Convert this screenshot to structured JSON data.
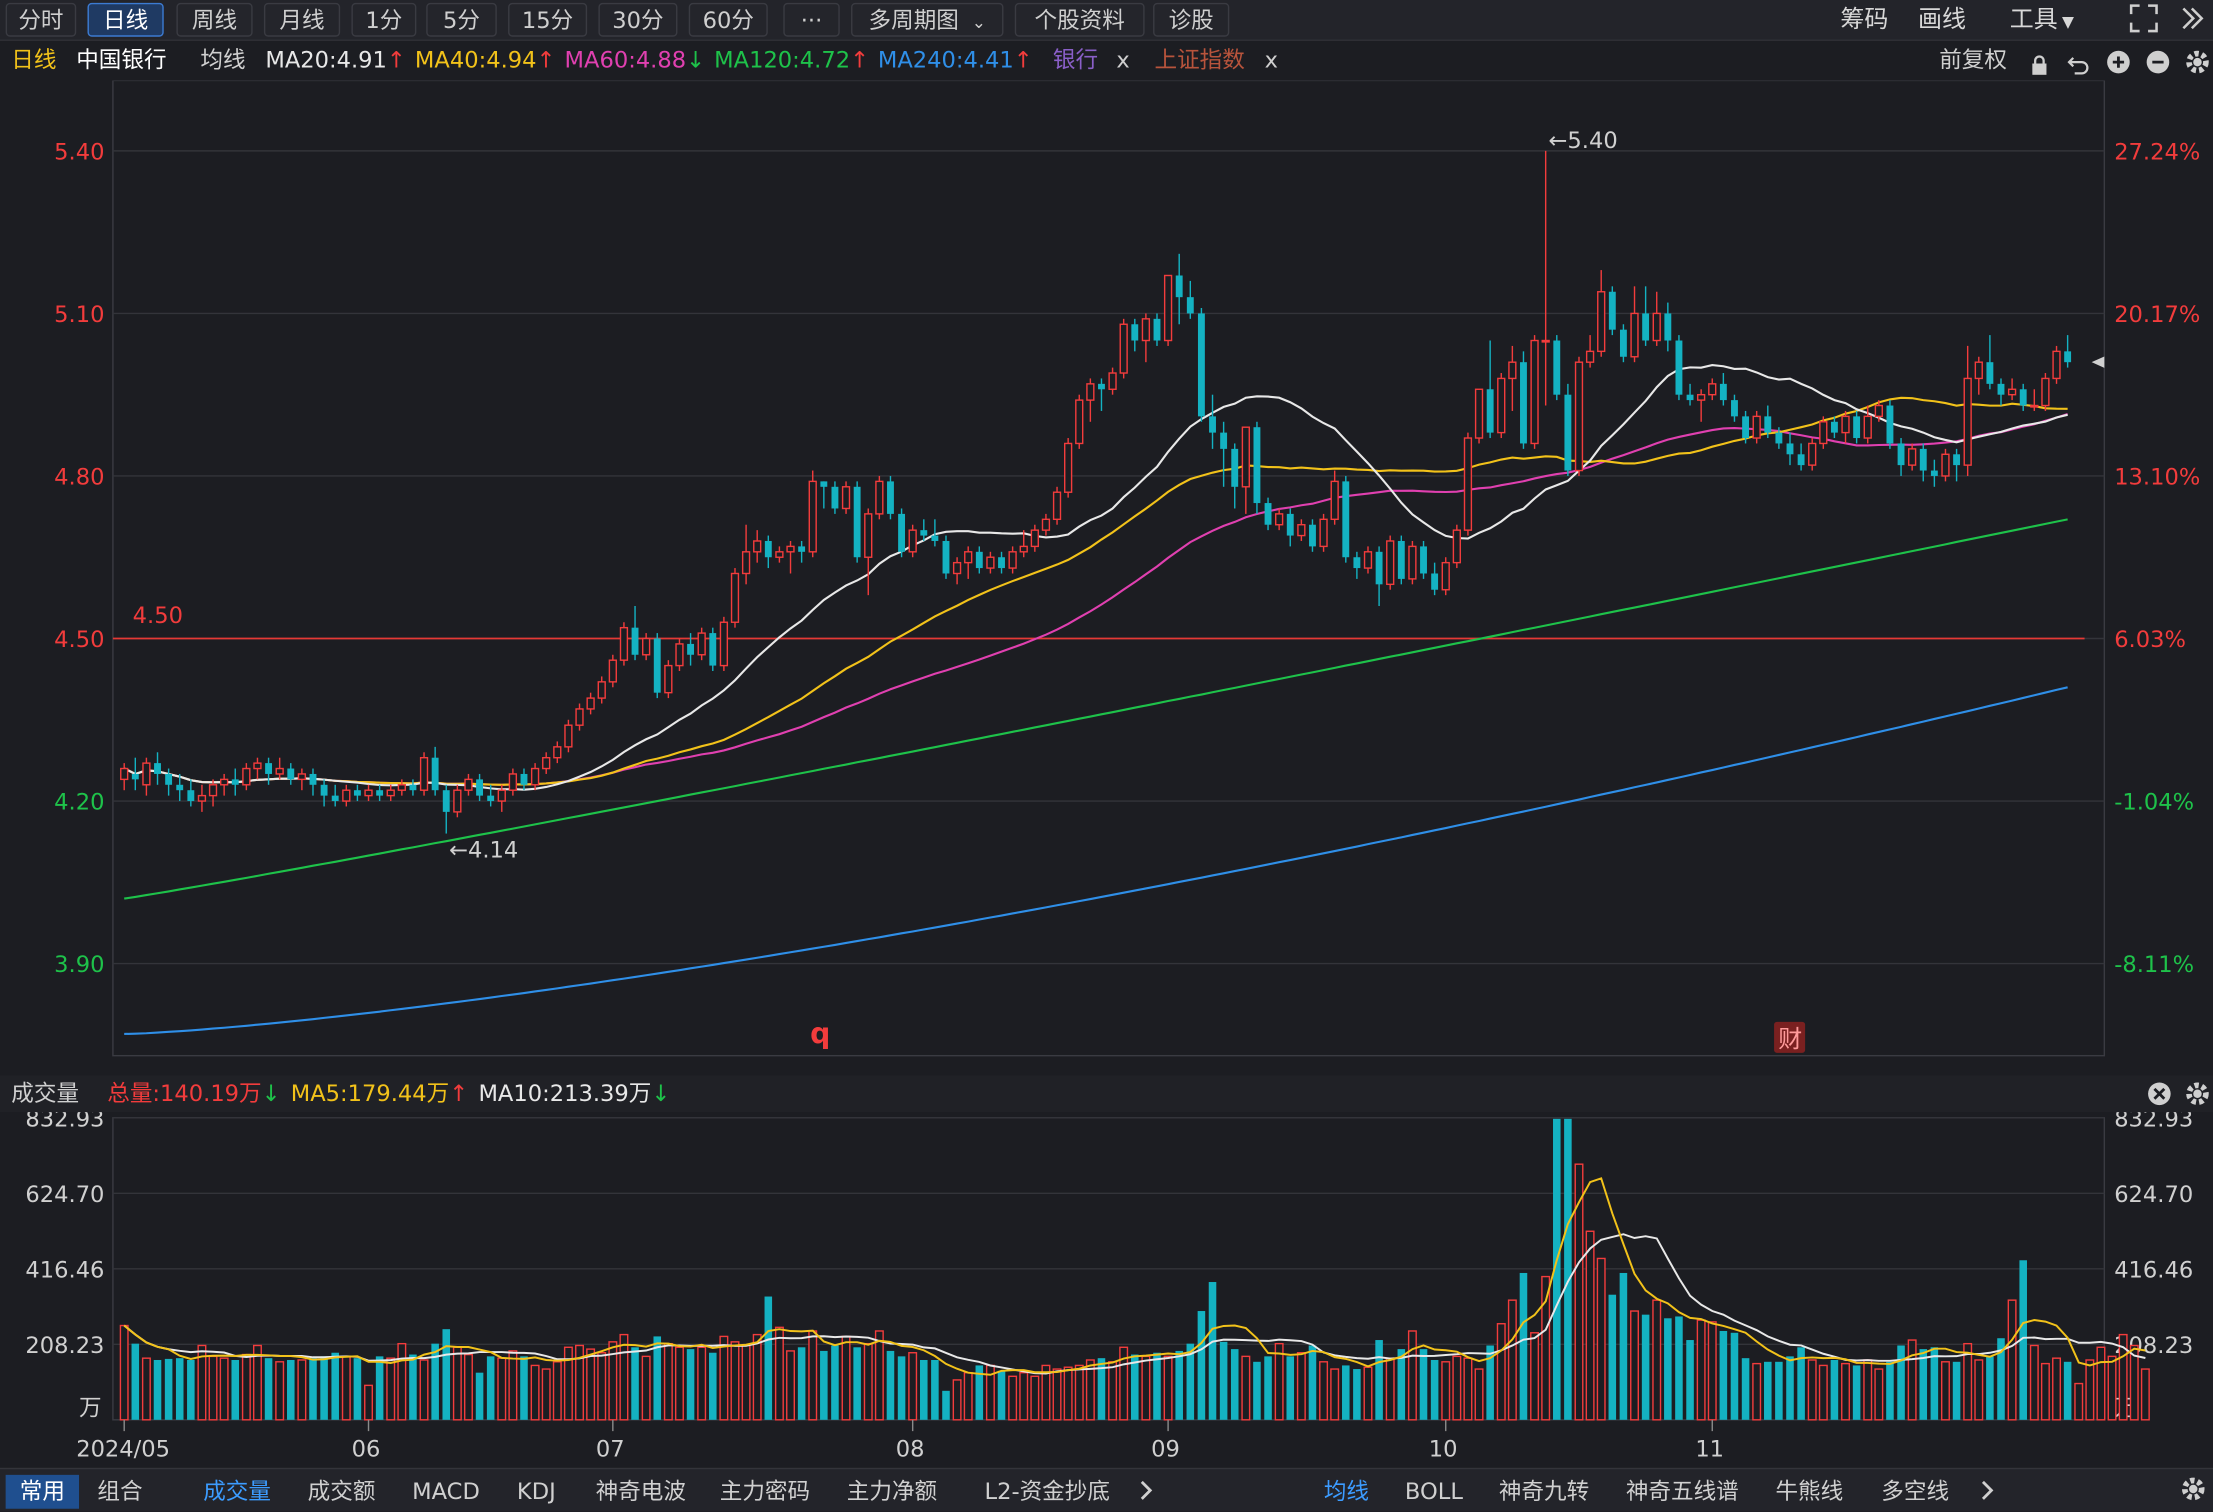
{
  "period_tabs": [
    {
      "label": "分时",
      "active": false
    },
    {
      "label": "日线",
      "active": true
    },
    {
      "label": "周线",
      "active": false
    },
    {
      "label": "月线",
      "active": false
    },
    {
      "label": "1分",
      "active": false
    },
    {
      "label": "5分",
      "active": false
    },
    {
      "label": "15分",
      "active": false
    },
    {
      "label": "30分",
      "active": false
    },
    {
      "label": "60分",
      "active": false
    }
  ],
  "toolbar": {
    "more_label": "···",
    "multi_period_label": "多周期图",
    "stock_info_label": "个股资料",
    "diagnose_label": "诊股",
    "chips_label": "筹码",
    "draw_label": "画线",
    "tools_label": "工具"
  },
  "info": {
    "period": "日线",
    "stock_name": "中国银行",
    "ma_type": "均线",
    "ma20": "MA20:4.91",
    "ma40": "MA40:4.94",
    "ma60": "MA60:4.88",
    "ma120": "MA120:4.72",
    "ma240": "MA240:4.41",
    "compare1": "银行",
    "compare2": "上证指数",
    "close_mark": "x",
    "adjust": "前复权"
  },
  "colors": {
    "up": "#f23c3c",
    "down": "#14b2c2",
    "ma20": "#e8e8e8",
    "ma40": "#f2c21a",
    "ma60": "#e040b0",
    "ma120": "#1ec24a",
    "ma240": "#2f8fe8",
    "grid": "#33343a"
  },
  "chart_data": [
    {
      "type": "candlestick",
      "title": "",
      "y_ticks_left": [
        "5.40",
        "5.10",
        "4.80",
        "4.50",
        "4.20",
        "3.90"
      ],
      "y_ticks_right": [
        "27.24%",
        "20.17%",
        "13.10%",
        "6.03%",
        "-1.04%",
        "-8.11%"
      ],
      "ylim": [
        3.73,
        5.53
      ],
      "x_labels": [
        "2024/05",
        "06",
        "07",
        "08",
        "09",
        "10",
        "11"
      ],
      "reference_line": {
        "value": 4.5,
        "label": "4.50"
      },
      "max_label": "←5.40",
      "min_label": "←4.14",
      "event_markers": [
        "q",
        "财"
      ],
      "candles": [
        [
          4.24,
          4.26,
          4.27,
          4.22
        ],
        [
          4.25,
          4.24,
          4.28,
          4.22
        ],
        [
          4.23,
          4.27,
          4.28,
          4.21
        ],
        [
          4.27,
          4.25,
          4.29,
          4.23
        ],
        [
          4.25,
          4.23,
          4.26,
          4.21
        ],
        [
          4.23,
          4.22,
          4.25,
          4.2
        ],
        [
          4.22,
          4.2,
          4.24,
          4.19
        ],
        [
          4.2,
          4.21,
          4.23,
          4.18
        ],
        [
          4.21,
          4.23,
          4.24,
          4.19
        ],
        [
          4.23,
          4.24,
          4.25,
          4.21
        ],
        [
          4.24,
          4.23,
          4.26,
          4.21
        ],
        [
          4.23,
          4.26,
          4.27,
          4.22
        ],
        [
          4.26,
          4.27,
          4.28,
          4.24
        ],
        [
          4.27,
          4.25,
          4.28,
          4.23
        ],
        [
          4.25,
          4.26,
          4.28,
          4.24
        ],
        [
          4.26,
          4.24,
          4.27,
          4.23
        ],
        [
          4.24,
          4.25,
          4.26,
          4.22
        ],
        [
          4.25,
          4.23,
          4.26,
          4.21
        ],
        [
          4.23,
          4.21,
          4.24,
          4.19
        ],
        [
          4.21,
          4.2,
          4.23,
          4.19
        ],
        [
          4.2,
          4.22,
          4.23,
          4.19
        ],
        [
          4.22,
          4.21,
          4.23,
          4.2
        ],
        [
          4.21,
          4.22,
          4.23,
          4.2
        ],
        [
          4.22,
          4.21,
          4.23,
          4.2
        ],
        [
          4.21,
          4.22,
          4.23,
          4.2
        ],
        [
          4.22,
          4.23,
          4.24,
          4.21
        ],
        [
          4.23,
          4.22,
          4.24,
          4.21
        ],
        [
          4.22,
          4.28,
          4.29,
          4.21
        ],
        [
          4.28,
          4.22,
          4.3,
          4.21
        ],
        [
          4.22,
          4.18,
          4.23,
          4.14
        ],
        [
          4.18,
          4.22,
          4.23,
          4.17
        ],
        [
          4.22,
          4.24,
          4.25,
          4.21
        ],
        [
          4.24,
          4.21,
          4.25,
          4.2
        ],
        [
          4.21,
          4.2,
          4.23,
          4.19
        ],
        [
          4.2,
          4.22,
          4.23,
          4.18
        ],
        [
          4.22,
          4.25,
          4.26,
          4.21
        ],
        [
          4.25,
          4.23,
          4.26,
          4.22
        ],
        [
          4.23,
          4.26,
          4.27,
          4.22
        ],
        [
          4.26,
          4.28,
          4.29,
          4.25
        ],
        [
          4.28,
          4.3,
          4.31,
          4.27
        ],
        [
          4.3,
          4.34,
          4.35,
          4.29
        ],
        [
          4.34,
          4.37,
          4.38,
          4.33
        ],
        [
          4.37,
          4.39,
          4.4,
          4.36
        ],
        [
          4.39,
          4.42,
          4.43,
          4.38
        ],
        [
          4.42,
          4.46,
          4.47,
          4.41
        ],
        [
          4.46,
          4.52,
          4.53,
          4.45
        ],
        [
          4.52,
          4.47,
          4.56,
          4.46
        ],
        [
          4.47,
          4.5,
          4.51,
          4.46
        ],
        [
          4.5,
          4.4,
          4.51,
          4.39
        ],
        [
          4.4,
          4.45,
          4.46,
          4.39
        ],
        [
          4.45,
          4.49,
          4.5,
          4.44
        ],
        [
          4.49,
          4.47,
          4.51,
          4.45
        ],
        [
          4.47,
          4.51,
          4.52,
          4.46
        ],
        [
          4.51,
          4.45,
          4.52,
          4.44
        ],
        [
          4.45,
          4.53,
          4.54,
          4.44
        ],
        [
          4.53,
          4.62,
          4.63,
          4.52
        ],
        [
          4.62,
          4.66,
          4.71,
          4.6
        ],
        [
          4.66,
          4.68,
          4.7,
          4.64
        ],
        [
          4.68,
          4.65,
          4.69,
          4.63
        ],
        [
          4.65,
          4.66,
          4.67,
          4.64
        ],
        [
          4.66,
          4.67,
          4.68,
          4.62
        ],
        [
          4.67,
          4.66,
          4.68,
          4.64
        ],
        [
          4.66,
          4.79,
          4.81,
          4.65
        ],
        [
          4.79,
          4.78,
          4.79,
          4.74
        ],
        [
          4.78,
          4.74,
          4.79,
          4.73
        ],
        [
          4.74,
          4.78,
          4.79,
          4.73
        ],
        [
          4.78,
          4.65,
          4.79,
          4.64
        ],
        [
          4.65,
          4.73,
          4.74,
          4.58
        ],
        [
          4.73,
          4.79,
          4.8,
          4.72
        ],
        [
          4.79,
          4.73,
          4.8,
          4.72
        ],
        [
          4.73,
          4.66,
          4.74,
          4.65
        ],
        [
          4.66,
          4.7,
          4.71,
          4.65
        ],
        [
          4.7,
          4.69,
          4.72,
          4.68
        ],
        [
          4.69,
          4.68,
          4.72,
          4.67
        ],
        [
          4.68,
          4.62,
          4.69,
          4.61
        ],
        [
          4.62,
          4.64,
          4.65,
          4.6
        ],
        [
          4.64,
          4.66,
          4.67,
          4.61
        ],
        [
          4.66,
          4.63,
          4.67,
          4.62
        ],
        [
          4.63,
          4.65,
          4.66,
          4.62
        ],
        [
          4.65,
          4.63,
          4.66,
          4.62
        ],
        [
          4.63,
          4.66,
          4.67,
          4.62
        ],
        [
          4.66,
          4.67,
          4.7,
          4.65
        ],
        [
          4.67,
          4.7,
          4.71,
          4.66
        ],
        [
          4.7,
          4.72,
          4.73,
          4.69
        ],
        [
          4.72,
          4.77,
          4.78,
          4.71
        ],
        [
          4.77,
          4.86,
          4.87,
          4.76
        ],
        [
          4.86,
          4.94,
          4.95,
          4.85
        ],
        [
          4.94,
          4.97,
          4.98,
          4.9
        ],
        [
          4.97,
          4.96,
          4.98,
          4.92
        ],
        [
          4.96,
          4.99,
          5.0,
          4.95
        ],
        [
          4.99,
          5.08,
          5.09,
          4.98
        ],
        [
          5.08,
          5.05,
          5.09,
          5.03
        ],
        [
          5.05,
          5.09,
          5.1,
          5.01
        ],
        [
          5.09,
          5.05,
          5.1,
          5.04
        ],
        [
          5.05,
          5.17,
          5.17,
          5.04
        ],
        [
          5.17,
          5.13,
          5.21,
          5.08
        ],
        [
          5.13,
          5.1,
          5.16,
          5.09
        ],
        [
          5.1,
          4.91,
          5.11,
          4.9
        ],
        [
          4.91,
          4.88,
          4.95,
          4.85
        ],
        [
          4.88,
          4.85,
          4.9,
          4.78
        ],
        [
          4.85,
          4.78,
          4.86,
          4.74
        ],
        [
          4.78,
          4.89,
          4.89,
          4.73
        ],
        [
          4.89,
          4.75,
          4.9,
          4.73
        ],
        [
          4.75,
          4.71,
          4.76,
          4.7
        ],
        [
          4.71,
          4.73,
          4.74,
          4.7
        ],
        [
          4.73,
          4.69,
          4.74,
          4.67
        ],
        [
          4.69,
          4.71,
          4.72,
          4.68
        ],
        [
          4.71,
          4.67,
          4.72,
          4.66
        ],
        [
          4.67,
          4.72,
          4.73,
          4.66
        ],
        [
          4.72,
          4.79,
          4.81,
          4.71
        ],
        [
          4.79,
          4.65,
          4.8,
          4.64
        ],
        [
          4.65,
          4.63,
          4.66,
          4.61
        ],
        [
          4.63,
          4.66,
          4.67,
          4.62
        ],
        [
          4.66,
          4.6,
          4.67,
          4.56
        ],
        [
          4.6,
          4.68,
          4.69,
          4.59
        ],
        [
          4.68,
          4.61,
          4.69,
          4.6
        ],
        [
          4.61,
          4.67,
          4.68,
          4.6
        ],
        [
          4.67,
          4.62,
          4.68,
          4.61
        ],
        [
          4.62,
          4.59,
          4.64,
          4.58
        ],
        [
          4.59,
          4.64,
          4.65,
          4.58
        ],
        [
          4.64,
          4.7,
          4.71,
          4.63
        ],
        [
          4.7,
          4.87,
          4.88,
          4.69
        ],
        [
          4.87,
          4.96,
          4.96,
          4.86
        ],
        [
          4.96,
          4.88,
          5.05,
          4.87
        ],
        [
          4.88,
          4.98,
          4.99,
          4.87
        ],
        [
          4.98,
          5.01,
          5.04,
          4.92
        ],
        [
          5.01,
          4.86,
          5.03,
          4.85
        ],
        [
          4.86,
          5.05,
          5.06,
          4.85
        ],
        [
          5.05,
          5.05,
          5.4,
          4.93
        ],
        [
          5.05,
          4.95,
          5.06,
          4.94
        ],
        [
          4.95,
          4.81,
          4.97,
          4.8
        ],
        [
          4.81,
          5.01,
          5.02,
          4.8
        ],
        [
          5.01,
          5.03,
          5.06,
          5.0
        ],
        [
          5.03,
          5.14,
          5.18,
          5.02
        ],
        [
          5.14,
          5.07,
          5.15,
          5.06
        ],
        [
          5.07,
          5.02,
          5.08,
          5.01
        ],
        [
          5.02,
          5.1,
          5.15,
          5.01
        ],
        [
          5.1,
          5.05,
          5.15,
          5.04
        ],
        [
          5.05,
          5.1,
          5.14,
          5.04
        ],
        [
          5.1,
          5.05,
          5.12,
          5.03
        ],
        [
          5.05,
          4.95,
          5.06,
          4.94
        ],
        [
          4.95,
          4.94,
          4.97,
          4.93
        ],
        [
          4.94,
          4.95,
          4.96,
          4.9
        ],
        [
          4.95,
          4.97,
          4.98,
          4.94
        ],
        [
          4.97,
          4.94,
          4.99,
          4.93
        ],
        [
          4.94,
          4.91,
          4.95,
          4.9
        ],
        [
          4.91,
          4.87,
          4.92,
          4.86
        ],
        [
          4.87,
          4.91,
          4.92,
          4.86
        ],
        [
          4.91,
          4.88,
          4.93,
          4.87
        ],
        [
          4.88,
          4.86,
          4.89,
          4.85
        ],
        [
          4.86,
          4.84,
          4.88,
          4.82
        ],
        [
          4.84,
          4.82,
          4.86,
          4.81
        ],
        [
          4.82,
          4.86,
          4.87,
          4.81
        ],
        [
          4.86,
          4.9,
          4.91,
          4.85
        ],
        [
          4.9,
          4.88,
          4.91,
          4.87
        ],
        [
          4.88,
          4.91,
          4.92,
          4.86
        ],
        [
          4.91,
          4.87,
          4.92,
          4.86
        ],
        [
          4.87,
          4.91,
          4.93,
          4.86
        ],
        [
          4.91,
          4.93,
          4.94,
          4.9
        ],
        [
          4.93,
          4.86,
          4.94,
          4.85
        ],
        [
          4.86,
          4.82,
          4.87,
          4.8
        ],
        [
          4.82,
          4.85,
          4.86,
          4.81
        ],
        [
          4.85,
          4.81,
          4.86,
          4.79
        ],
        [
          4.81,
          4.8,
          4.83,
          4.78
        ],
        [
          4.8,
          4.84,
          4.85,
          4.79
        ],
        [
          4.84,
          4.82,
          4.85,
          4.79
        ],
        [
          4.82,
          4.98,
          5.04,
          4.8
        ],
        [
          4.98,
          5.01,
          5.02,
          4.95
        ],
        [
          5.01,
          4.97,
          5.06,
          4.96
        ],
        [
          4.97,
          4.95,
          4.98,
          4.93
        ],
        [
          4.95,
          4.96,
          4.98,
          4.94
        ],
        [
          4.96,
          4.93,
          4.97,
          4.92
        ],
        [
          4.93,
          4.93,
          4.96,
          4.92
        ],
        [
          4.93,
          4.98,
          4.99,
          4.92
        ],
        [
          4.98,
          5.03,
          5.04,
          4.97
        ],
        [
          5.03,
          5.01,
          5.06,
          5.0
        ]
      ]
    },
    {
      "type": "bar",
      "title": "",
      "unit": "万",
      "y_ticks": [
        "832.93",
        "624.70",
        "416.46",
        "208.23"
      ],
      "ylim": [
        0,
        832.93
      ],
      "total_label": "总量:140.19万",
      "ma5_label": "MA5:179.44万",
      "ma10_label": "MA10:213.39万",
      "values": [
        260,
        210,
        170,
        165,
        168,
        170,
        165,
        205,
        175,
        170,
        165,
        180,
        205,
        170,
        160,
        165,
        165,
        170,
        175,
        185,
        175,
        170,
        95,
        175,
        170,
        210,
        180,
        165,
        210,
        250,
        200,
        180,
        130,
        175,
        170,
        190,
        175,
        150,
        140,
        160,
        200,
        205,
        195,
        185,
        215,
        235,
        200,
        175,
        230,
        210,
        200,
        195,
        200,
        185,
        230,
        215,
        205,
        235,
        340,
        255,
        190,
        200,
        245,
        190,
        205,
        230,
        200,
        210,
        245,
        190,
        175,
        185,
        165,
        165,
        80,
        110,
        130,
        150,
        150,
        135,
        120,
        130,
        120,
        150,
        140,
        145,
        150,
        165,
        170,
        160,
        200,
        180,
        175,
        185,
        175,
        190,
        210,
        300,
        380,
        215,
        195,
        175,
        160,
        175,
        210,
        175,
        185,
        205,
        160,
        140,
        150,
        140,
        145,
        220,
        170,
        195,
        245,
        195,
        165,
        160,
        175,
        170,
        140,
        205,
        265,
        330,
        405,
        240,
        395,
        830,
        830,
        705,
        520,
        445,
        345,
        405,
        300,
        290,
        330,
        280,
        285,
        220,
        275,
        270,
        245,
        240,
        170,
        155,
        160,
        160,
        175,
        200,
        165,
        150,
        165,
        155,
        150,
        165,
        140,
        160,
        205,
        220,
        195,
        200,
        160,
        160,
        210,
        165,
        175,
        225,
        330,
        440,
        205,
        155,
        170,
        160,
        100,
        165,
        200,
        175,
        235,
        205,
        140
      ]
    }
  ],
  "volume": {
    "title": "成交量",
    "total": "总量:140.19万",
    "ma5": "MA5:179.44万",
    "ma10": "MA10:213.39万"
  },
  "bottom_tabs_left": [
    "常用",
    "组合"
  ],
  "bottom_tabs_indicators": [
    "成交量",
    "成交额",
    "MACD",
    "KDJ",
    "神奇电波",
    "主力密码",
    "主力净额",
    "L2-资金抄底"
  ],
  "bottom_tabs_overlays": [
    "均线",
    "BOLL",
    "神奇九转",
    "神奇五线谱",
    "牛熊线",
    "多空线"
  ]
}
